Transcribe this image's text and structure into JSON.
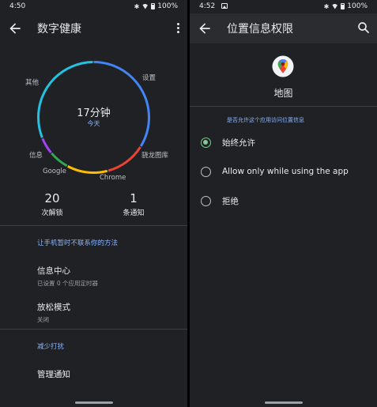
{
  "left": {
    "status": {
      "time": "4:50",
      "battery": "100%"
    },
    "appbar": {
      "title": "数字健康"
    },
    "dashboard": {
      "total_time": "17分钟",
      "period": "今天",
      "segments": [
        {
          "label": "设置",
          "color": "#4285f4",
          "fraction": 0.34
        },
        {
          "label": "骁龙图库",
          "color": "#ea4335",
          "fraction": 0.12
        },
        {
          "label": "Chrome",
          "color": "#fbbc04",
          "fraction": 0.12
        },
        {
          "label": "Google",
          "color": "#34a853",
          "fraction": 0.06
        },
        {
          "label": "信息",
          "color": "#a142f4",
          "fraction": 0.05
        },
        {
          "label": "其他",
          "color": "#24c1e0",
          "fraction": 0.31
        }
      ],
      "unlocks": {
        "value": "20",
        "label": "次解锁"
      },
      "notifications": {
        "value": "1",
        "label": "条通知"
      }
    },
    "sections": [
      {
        "header": "让手机暂时不联系你的方法",
        "items": [
          {
            "title": "信息中心",
            "subtitle": "已设置 0 个应用定时器"
          },
          {
            "title": "放松模式",
            "subtitle": "关闭"
          }
        ]
      },
      {
        "header": "减少打扰",
        "items": [
          {
            "title": "管理通知"
          }
        ]
      }
    ]
  },
  "right": {
    "status": {
      "time": "4:52",
      "battery": "100%"
    },
    "appbar": {
      "title": "位置信息权限"
    },
    "app": {
      "name": "地图",
      "icon": "google-maps-icon"
    },
    "section_header": "是否允许这个应用访问位置信息",
    "options": [
      {
        "label": "始终允许",
        "selected": true
      },
      {
        "label": "Allow only while using the app",
        "selected": false
      },
      {
        "label": "拒绝",
        "selected": false
      }
    ],
    "accent_color": "#81c995"
  }
}
